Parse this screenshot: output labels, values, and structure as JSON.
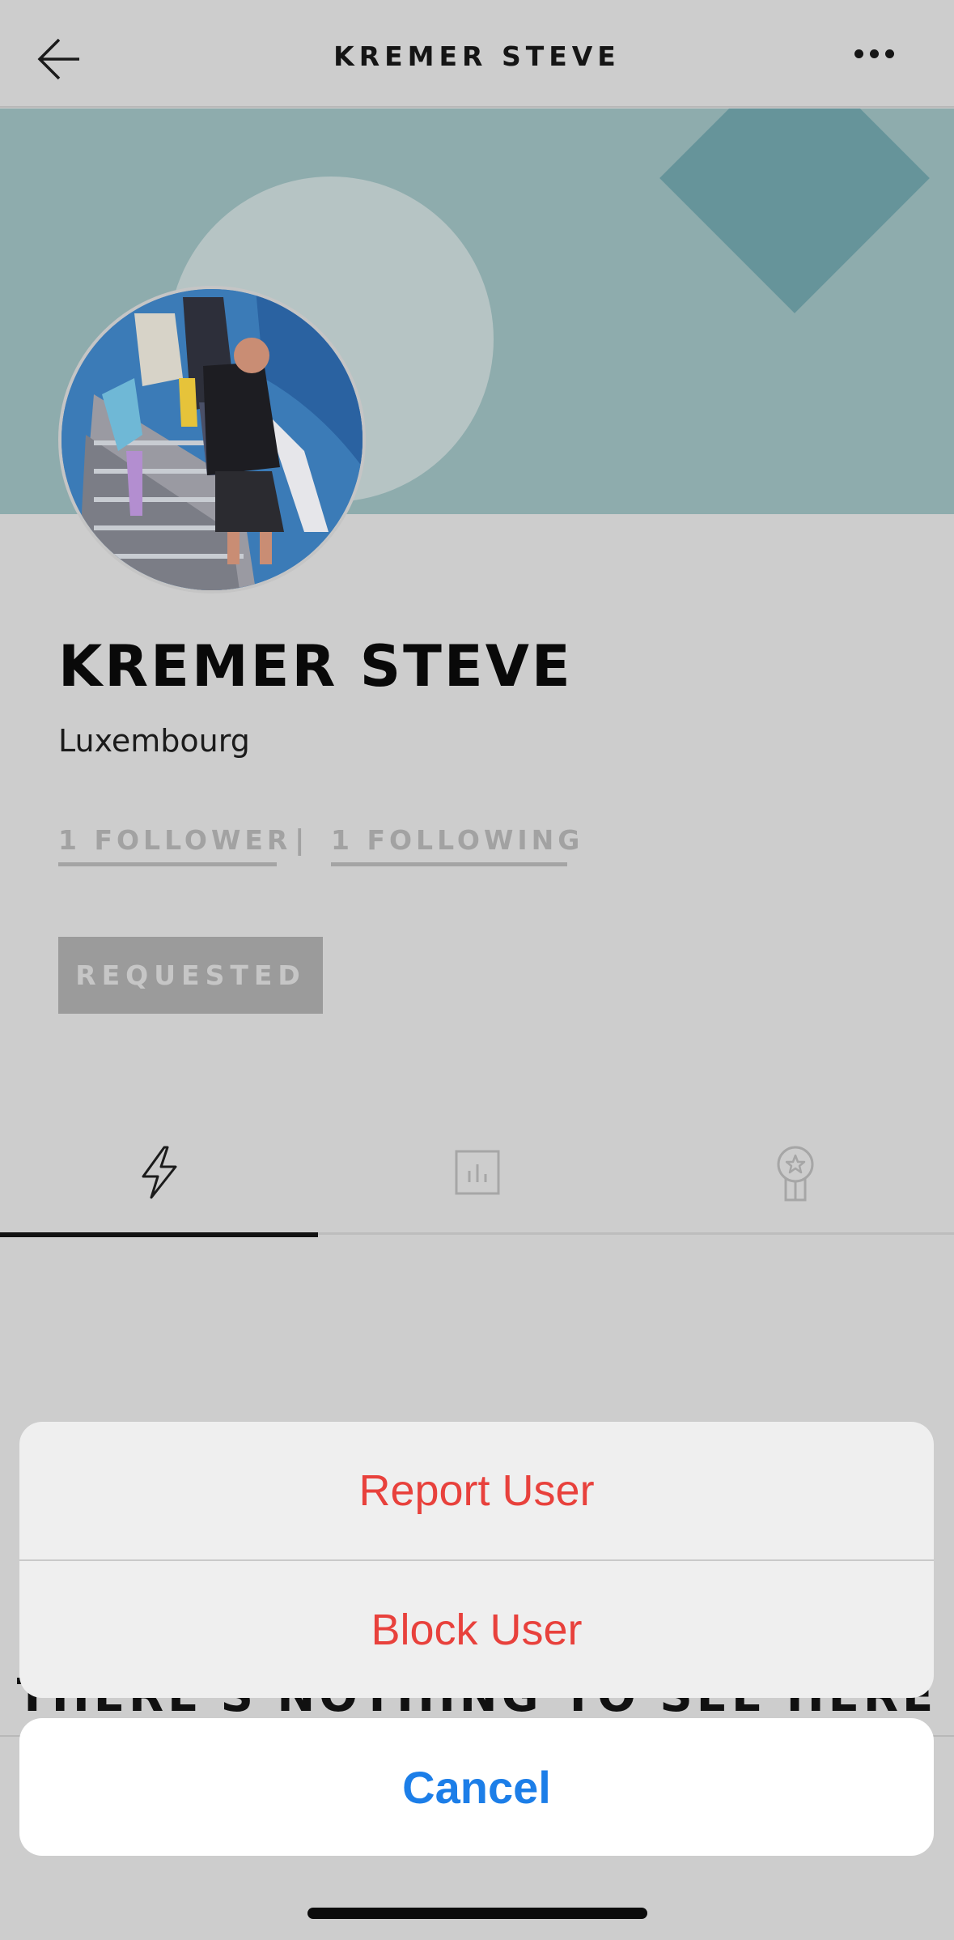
{
  "navbar": {
    "title": "KREMER STEVE",
    "back_icon": "arrow-left-icon",
    "more_icon": "ellipsis-icon"
  },
  "profile": {
    "name": "KREMER STEVE",
    "location": "Luxembourg",
    "followers_label": "1 FOLLOWER",
    "following_label": "1 FOLLOWING",
    "separator": "|",
    "request_button": "REQUESTED"
  },
  "tabs": [
    {
      "icon": "activity-bolt-icon",
      "active": true
    },
    {
      "icon": "stats-chart-icon",
      "active": false
    },
    {
      "icon": "achievement-medal-icon",
      "active": false
    }
  ],
  "empty_state": {
    "text": "THERE'S NOTHING TO SEE HERE"
  },
  "action_sheet": {
    "report_label": "Report User",
    "block_label": "Block User",
    "cancel_label": "Cancel"
  },
  "colors": {
    "banner": "#8eacad",
    "banner_circle": "#b6c4c4",
    "banner_diamond": "#66949a",
    "destructive": "#e8413c",
    "cancel": "#1c7ee8"
  }
}
